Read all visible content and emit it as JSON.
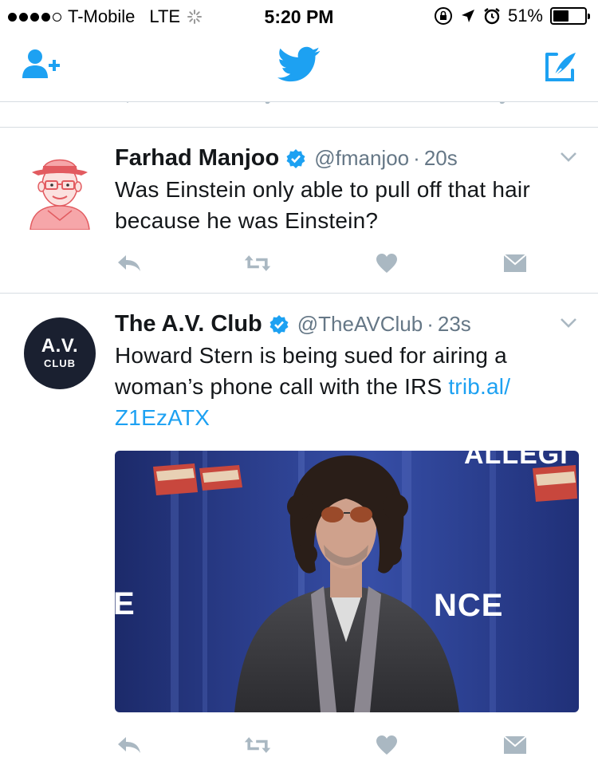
{
  "status_bar": {
    "carrier": "T-Mobile",
    "network": "LTE",
    "time": "5:20 PM",
    "battery_percent": "51%",
    "battery_level": 0.51,
    "signal_bars": 4
  },
  "nav": {
    "add_user_icon": "add-user-icon",
    "logo_icon": "twitter-bird-icon",
    "compose_icon": "compose-tweet-icon",
    "accent": "#1da1f2"
  },
  "tweets": [
    {
      "name": "Farhad Manjoo",
      "handle": "@fmanjoo",
      "separator": "·",
      "time": "20s",
      "verified": true,
      "text": "Was Einstein only able to pull off that hair because he was Einstein?"
    },
    {
      "name": "The A.V. Club",
      "handle": "@TheAVClub",
      "separator": "·",
      "time": "23s",
      "verified": true,
      "text": "Howard Stern is being sued for airing a woman’s phone call with the IRS ",
      "link_line1": "trib.al/",
      "link_line2": "Z1EzATX",
      "avatar_text_top": "A.V.",
      "avatar_text_bottom": "CLUB",
      "media": {
        "backdrop_text_left": "E",
        "backdrop_text_right": "NCE",
        "backdrop_text_top": "ALLEGI"
      }
    }
  ]
}
